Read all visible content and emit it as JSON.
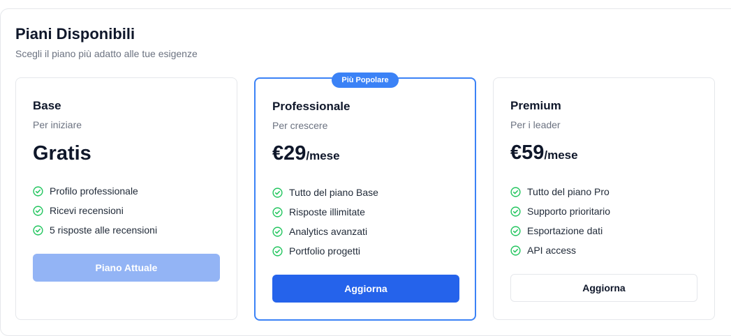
{
  "header": {
    "title": "Piani Disponibili",
    "subtitle": "Scegli il piano più adatto alle tue esigenze"
  },
  "plans": [
    {
      "name": "Base",
      "tagline": "Per iniziare",
      "price": "Gratis",
      "period": "",
      "features": [
        "Profilo professionale",
        "Ricevi recensioni",
        "5 risposte alle recensioni"
      ],
      "button_label": "Piano Attuale",
      "button_state": "disabled"
    },
    {
      "name": "Professionale",
      "tagline": "Per crescere",
      "price": "€29",
      "period": "/mese",
      "badge": "Più Popolare",
      "features": [
        "Tutto del piano Base",
        "Risposte illimitate",
        "Analytics avanzati",
        "Portfolio progetti"
      ],
      "button_label": "Aggiorna",
      "button_state": "primary"
    },
    {
      "name": "Premium",
      "tagline": "Per i leader",
      "price": "€59",
      "period": "/mese",
      "features": [
        "Tutto del piano Pro",
        "Supporto prioritario",
        "Esportazione dati",
        "API access"
      ],
      "button_label": "Aggiorna",
      "button_state": "outline"
    }
  ],
  "icons": {
    "feature": "check-circle-icon"
  },
  "colors": {
    "accent": "#2563eb",
    "badge": "#3b82f6",
    "check": "#22c55e",
    "disabled_button": "#93b4f5"
  }
}
